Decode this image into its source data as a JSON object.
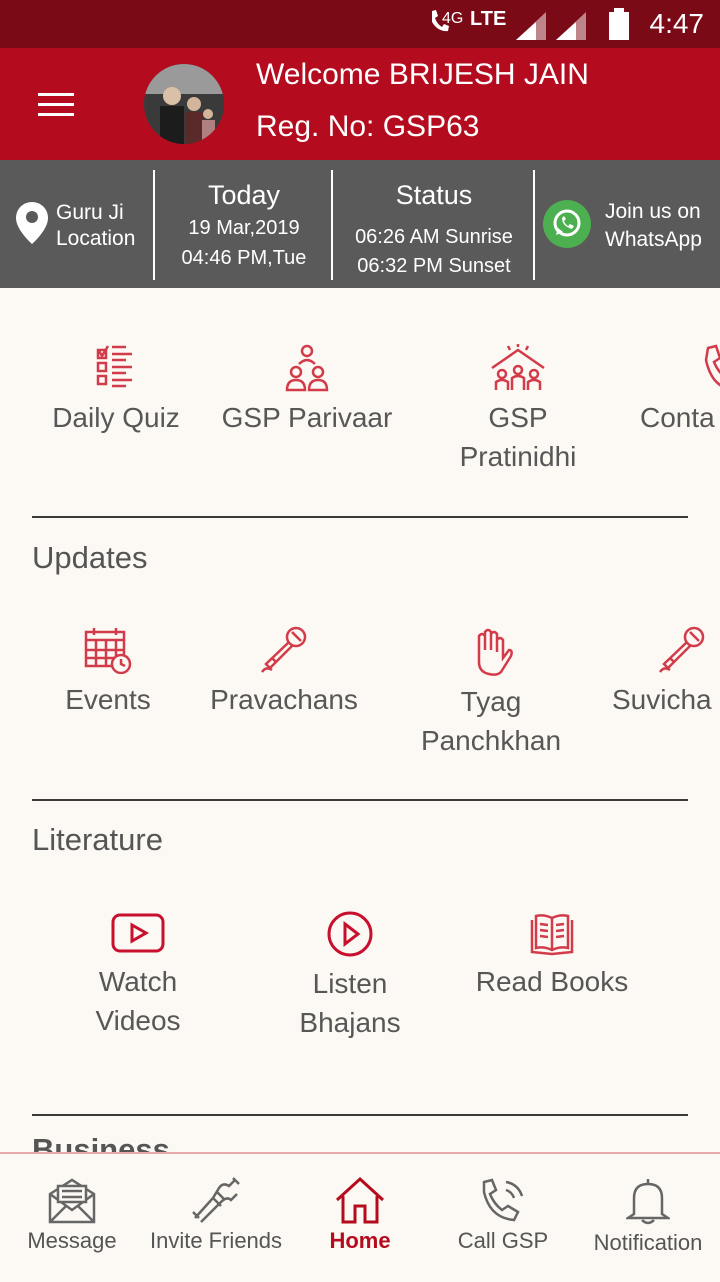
{
  "status_bar": {
    "network": "4G",
    "lte": "LTE",
    "time": "4:47"
  },
  "header": {
    "welcome": "Welcome BRIJESH JAIN",
    "reg_no": "Reg. No: GSP63"
  },
  "info": {
    "location": {
      "line1": "Guru Ji",
      "line2": "Location"
    },
    "today": {
      "title": "Today",
      "date": "19 Mar,2019",
      "time": "04:46 PM,Tue"
    },
    "status": {
      "title": "Status",
      "sunrise": "06:26 AM Sunrise",
      "sunset": "06:32 PM Sunset"
    },
    "whatsapp": {
      "line1": "Join us on",
      "line2": "WhatsApp"
    }
  },
  "top_items": [
    {
      "label": "Daily Quiz",
      "icon": "checklist-icon"
    },
    {
      "label": "GSP Parivaar",
      "icon": "family-icon"
    },
    {
      "label_l1": "GSP",
      "label_l2": "Pratinidhi",
      "icon": "house-people-icon"
    },
    {
      "label": "Conta",
      "icon": "phone-icon"
    }
  ],
  "updates": {
    "title": "Updates",
    "items": [
      {
        "label": "Events",
        "icon": "calendar-icon"
      },
      {
        "label": "Pravachans",
        "icon": "microphone-icon"
      },
      {
        "label_l1": "Tyag",
        "label_l2": "Panchkhan",
        "icon": "hand-icon"
      },
      {
        "label": "Suvicha",
        "icon": "microphone-icon"
      }
    ]
  },
  "literature": {
    "title": "Literature",
    "items": [
      {
        "label_l1": "Watch",
        "label_l2": "Videos",
        "icon": "video-play-icon"
      },
      {
        "label_l1": "Listen",
        "label_l2": "Bhajans",
        "icon": "audio-play-icon"
      },
      {
        "label": "Read Books",
        "icon": "book-icon"
      }
    ]
  },
  "business": {
    "title": "Business"
  },
  "bottom_nav": [
    {
      "label": "Message",
      "icon": "envelope-icon"
    },
    {
      "label": "Invite Friends",
      "icon": "handshake-icon"
    },
    {
      "label": "Home",
      "icon": "home-icon"
    },
    {
      "label": "Call GSP",
      "icon": "phone-call-icon"
    },
    {
      "label": "Notification",
      "icon": "bell-icon"
    }
  ],
  "colors": {
    "primary": "#b50b1e",
    "status_bar": "#7a0a16",
    "info_bar": "#5a5a5a",
    "icon_red": "#d23b4a",
    "background": "#fcf8f3"
  }
}
